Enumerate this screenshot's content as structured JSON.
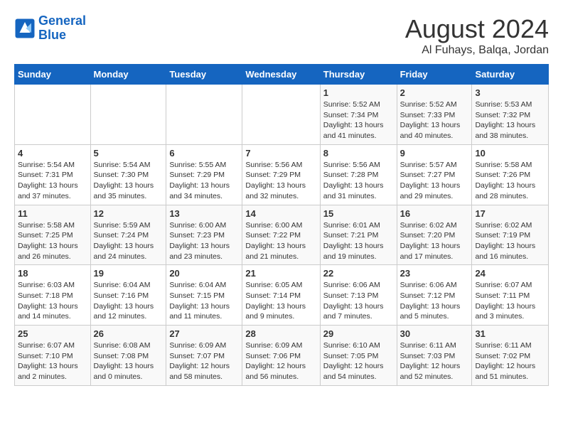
{
  "header": {
    "logo_line1": "General",
    "logo_line2": "Blue",
    "main_title": "August 2024",
    "subtitle": "Al Fuhays, Balqa, Jordan"
  },
  "days_of_week": [
    "Sunday",
    "Monday",
    "Tuesday",
    "Wednesday",
    "Thursday",
    "Friday",
    "Saturday"
  ],
  "weeks": [
    [
      {
        "day": "",
        "info": ""
      },
      {
        "day": "",
        "info": ""
      },
      {
        "day": "",
        "info": ""
      },
      {
        "day": "",
        "info": ""
      },
      {
        "day": "1",
        "info": "Sunrise: 5:52 AM\nSunset: 7:34 PM\nDaylight: 13 hours\nand 41 minutes."
      },
      {
        "day": "2",
        "info": "Sunrise: 5:52 AM\nSunset: 7:33 PM\nDaylight: 13 hours\nand 40 minutes."
      },
      {
        "day": "3",
        "info": "Sunrise: 5:53 AM\nSunset: 7:32 PM\nDaylight: 13 hours\nand 38 minutes."
      }
    ],
    [
      {
        "day": "4",
        "info": "Sunrise: 5:54 AM\nSunset: 7:31 PM\nDaylight: 13 hours\nand 37 minutes."
      },
      {
        "day": "5",
        "info": "Sunrise: 5:54 AM\nSunset: 7:30 PM\nDaylight: 13 hours\nand 35 minutes."
      },
      {
        "day": "6",
        "info": "Sunrise: 5:55 AM\nSunset: 7:29 PM\nDaylight: 13 hours\nand 34 minutes."
      },
      {
        "day": "7",
        "info": "Sunrise: 5:56 AM\nSunset: 7:29 PM\nDaylight: 13 hours\nand 32 minutes."
      },
      {
        "day": "8",
        "info": "Sunrise: 5:56 AM\nSunset: 7:28 PM\nDaylight: 13 hours\nand 31 minutes."
      },
      {
        "day": "9",
        "info": "Sunrise: 5:57 AM\nSunset: 7:27 PM\nDaylight: 13 hours\nand 29 minutes."
      },
      {
        "day": "10",
        "info": "Sunrise: 5:58 AM\nSunset: 7:26 PM\nDaylight: 13 hours\nand 28 minutes."
      }
    ],
    [
      {
        "day": "11",
        "info": "Sunrise: 5:58 AM\nSunset: 7:25 PM\nDaylight: 13 hours\nand 26 minutes."
      },
      {
        "day": "12",
        "info": "Sunrise: 5:59 AM\nSunset: 7:24 PM\nDaylight: 13 hours\nand 24 minutes."
      },
      {
        "day": "13",
        "info": "Sunrise: 6:00 AM\nSunset: 7:23 PM\nDaylight: 13 hours\nand 23 minutes."
      },
      {
        "day": "14",
        "info": "Sunrise: 6:00 AM\nSunset: 7:22 PM\nDaylight: 13 hours\nand 21 minutes."
      },
      {
        "day": "15",
        "info": "Sunrise: 6:01 AM\nSunset: 7:21 PM\nDaylight: 13 hours\nand 19 minutes."
      },
      {
        "day": "16",
        "info": "Sunrise: 6:02 AM\nSunset: 7:20 PM\nDaylight: 13 hours\nand 17 minutes."
      },
      {
        "day": "17",
        "info": "Sunrise: 6:02 AM\nSunset: 7:19 PM\nDaylight: 13 hours\nand 16 minutes."
      }
    ],
    [
      {
        "day": "18",
        "info": "Sunrise: 6:03 AM\nSunset: 7:18 PM\nDaylight: 13 hours\nand 14 minutes."
      },
      {
        "day": "19",
        "info": "Sunrise: 6:04 AM\nSunset: 7:16 PM\nDaylight: 13 hours\nand 12 minutes."
      },
      {
        "day": "20",
        "info": "Sunrise: 6:04 AM\nSunset: 7:15 PM\nDaylight: 13 hours\nand 11 minutes."
      },
      {
        "day": "21",
        "info": "Sunrise: 6:05 AM\nSunset: 7:14 PM\nDaylight: 13 hours\nand 9 minutes."
      },
      {
        "day": "22",
        "info": "Sunrise: 6:06 AM\nSunset: 7:13 PM\nDaylight: 13 hours\nand 7 minutes."
      },
      {
        "day": "23",
        "info": "Sunrise: 6:06 AM\nSunset: 7:12 PM\nDaylight: 13 hours\nand 5 minutes."
      },
      {
        "day": "24",
        "info": "Sunrise: 6:07 AM\nSunset: 7:11 PM\nDaylight: 13 hours\nand 3 minutes."
      }
    ],
    [
      {
        "day": "25",
        "info": "Sunrise: 6:07 AM\nSunset: 7:10 PM\nDaylight: 13 hours\nand 2 minutes."
      },
      {
        "day": "26",
        "info": "Sunrise: 6:08 AM\nSunset: 7:08 PM\nDaylight: 13 hours\nand 0 minutes."
      },
      {
        "day": "27",
        "info": "Sunrise: 6:09 AM\nSunset: 7:07 PM\nDaylight: 12 hours\nand 58 minutes."
      },
      {
        "day": "28",
        "info": "Sunrise: 6:09 AM\nSunset: 7:06 PM\nDaylight: 12 hours\nand 56 minutes."
      },
      {
        "day": "29",
        "info": "Sunrise: 6:10 AM\nSunset: 7:05 PM\nDaylight: 12 hours\nand 54 minutes."
      },
      {
        "day": "30",
        "info": "Sunrise: 6:11 AM\nSunset: 7:03 PM\nDaylight: 12 hours\nand 52 minutes."
      },
      {
        "day": "31",
        "info": "Sunrise: 6:11 AM\nSunset: 7:02 PM\nDaylight: 12 hours\nand 51 minutes."
      }
    ]
  ]
}
